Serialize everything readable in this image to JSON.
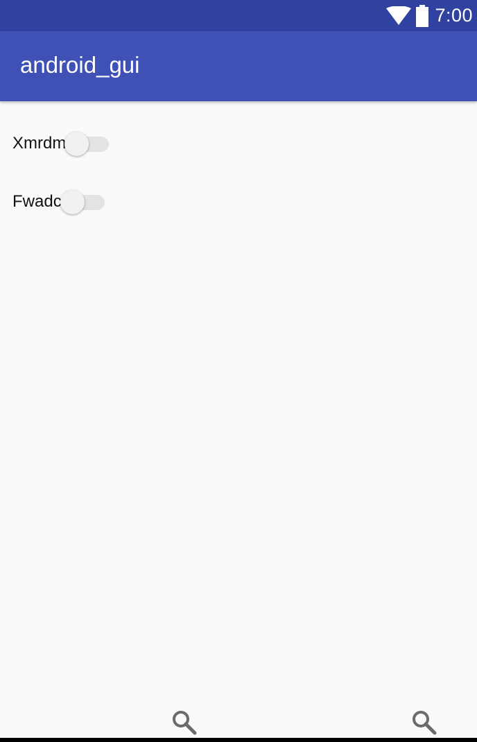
{
  "status_bar": {
    "time": "7:00",
    "wifi_icon": "wifi-icon",
    "battery_icon": "battery-icon"
  },
  "app_bar": {
    "title": "android_gui"
  },
  "switches": [
    {
      "label": "Xmrdm",
      "checked": false
    },
    {
      "label": "Fwadc",
      "checked": false
    }
  ],
  "bottom_nav": {
    "icons": [
      "search-icon",
      "search-icon"
    ]
  },
  "colors": {
    "status_bar": "#3041a0",
    "app_bar": "#3f51b5",
    "background": "#fafafa"
  }
}
